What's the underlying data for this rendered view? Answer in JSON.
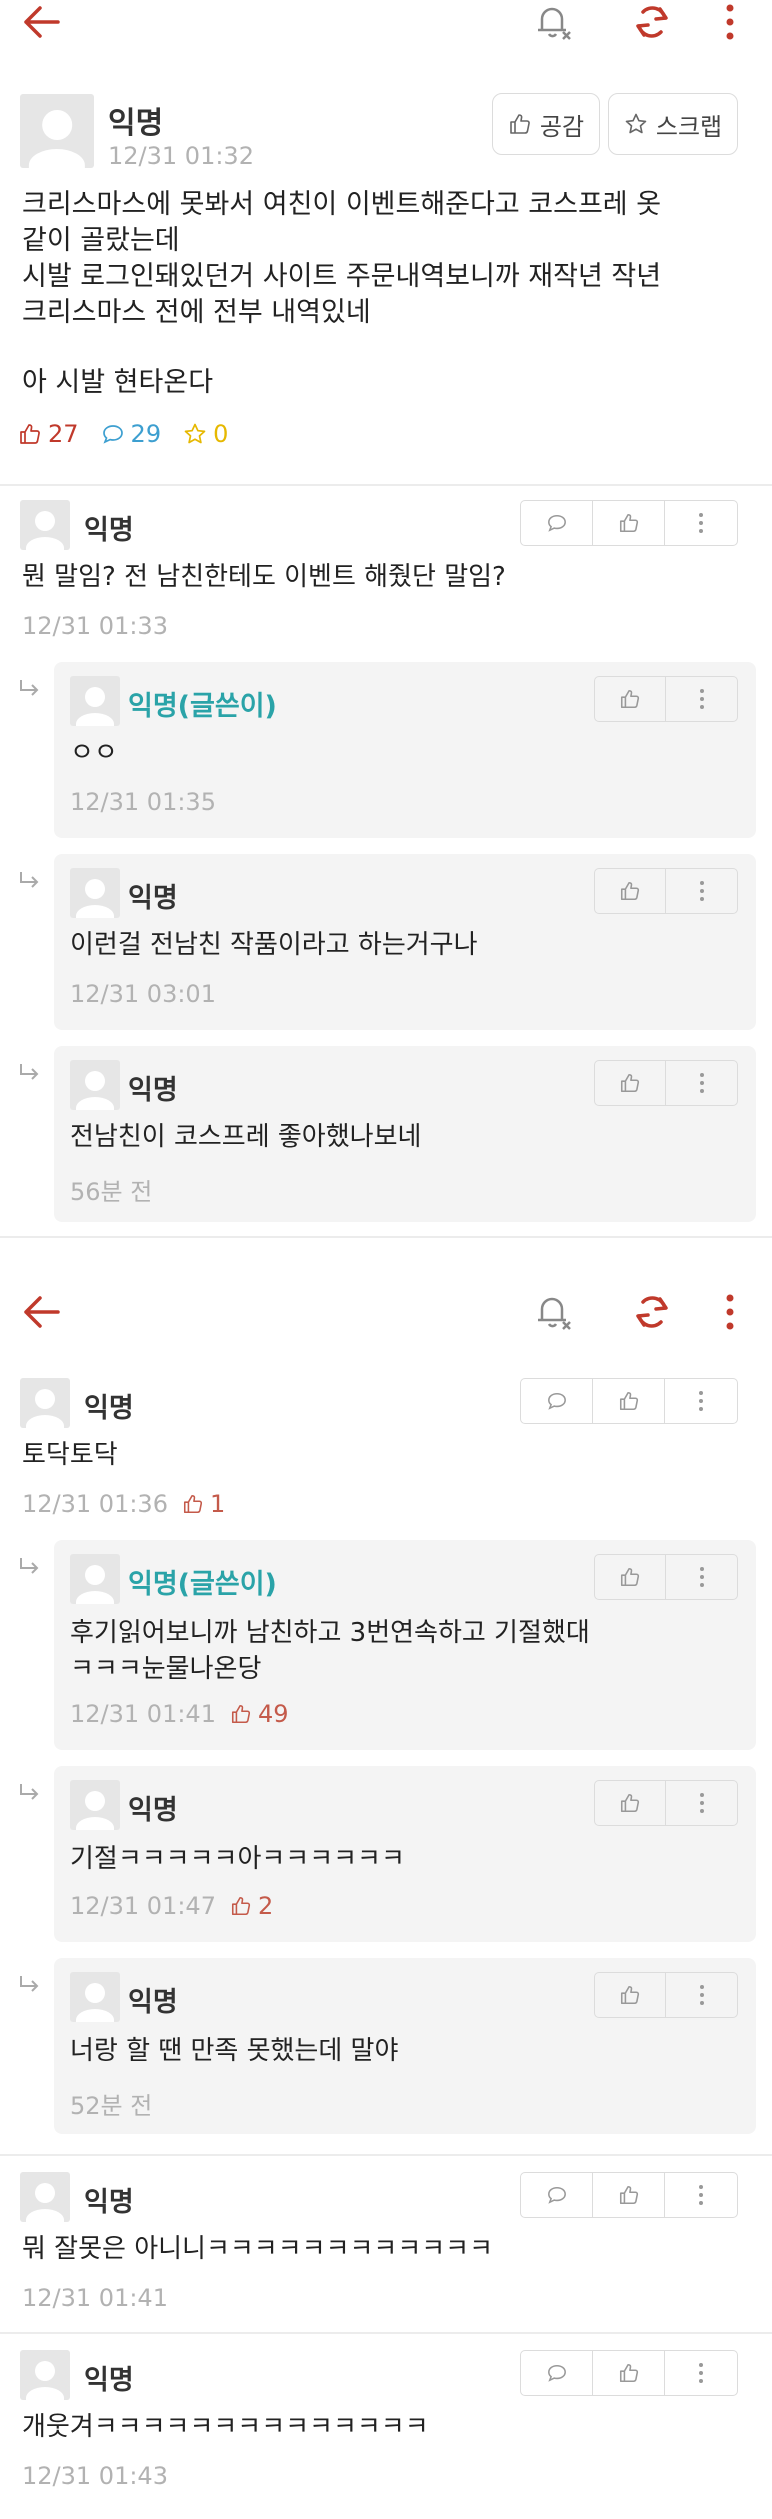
{
  "post": {
    "author": "익명",
    "time": "12/31 01:32",
    "like_button": "공감",
    "scrap_button": "스크랩",
    "lines": [
      "크리스마스에 못봐서 여친이 이벤트해준다고 코스프레 옷",
      "같이 골랐는데",
      "시발 로그인돼있던거 사이트 주문내역보니까 재작년 작년",
      "크리스마스 전에 전부 내역있네",
      "아 시발 현타온다"
    ],
    "likes": "27",
    "comments": "29",
    "scraps": "0"
  },
  "comments_top": [
    {
      "author": "익명",
      "text": "뭔 말임? 전 남친한테도 이벤트 해줬단 말임?",
      "time": "12/31 01:33",
      "likes": ""
    },
    {
      "author": "익명(글쓴이)",
      "text": "ㅇㅇ",
      "time": "12/31 01:35",
      "likes": ""
    },
    {
      "author": "익명",
      "text": "이런걸 전남친 작품이라고 하는거구나",
      "time": "12/31 03:01",
      "likes": ""
    },
    {
      "author": "익명",
      "text": "전남친이 코스프레 좋아했나보네",
      "time": "56분 전",
      "likes": ""
    }
  ],
  "comments_bottom": [
    {
      "author": "익명",
      "text": "토닥토닥",
      "time": "12/31 01:36",
      "likes": "1"
    },
    {
      "author": "익명(글쓴이)",
      "text": "후기읽어보니까 남친하고 3번연속하고 기절했대",
      "text2": "ㅋㅋㅋ눈물나온당",
      "time": "12/31 01:41",
      "likes": "49"
    },
    {
      "author": "익명",
      "text": "기절ㅋㅋㅋㅋㅋ아ㅋㅋㅋㅋㅋㅋ",
      "time": "12/31 01:47",
      "likes": "2"
    },
    {
      "author": "익명",
      "text": "너랑 할 땐 만족 못했는데 말야",
      "time": "52분 전",
      "likes": ""
    },
    {
      "author": "익명",
      "text": "뭐 잘못은 아니니ㅋㅋㅋㅋㅋㅋㅋㅋㅋㅋㅋㅋ",
      "time": "12/31 01:41",
      "likes": ""
    },
    {
      "author": "익명",
      "text": "개웃겨ㅋㅋㅋㅋㅋㅋㅋㅋㅋㅋㅋㅋㅋㅋ",
      "time": "12/31 01:43",
      "likes": ""
    }
  ],
  "colors": {
    "accent": "#c0392b",
    "writer": "#2aa3a8",
    "comment_count": "#3d9fd0",
    "scrap_count": "#e6b800"
  }
}
